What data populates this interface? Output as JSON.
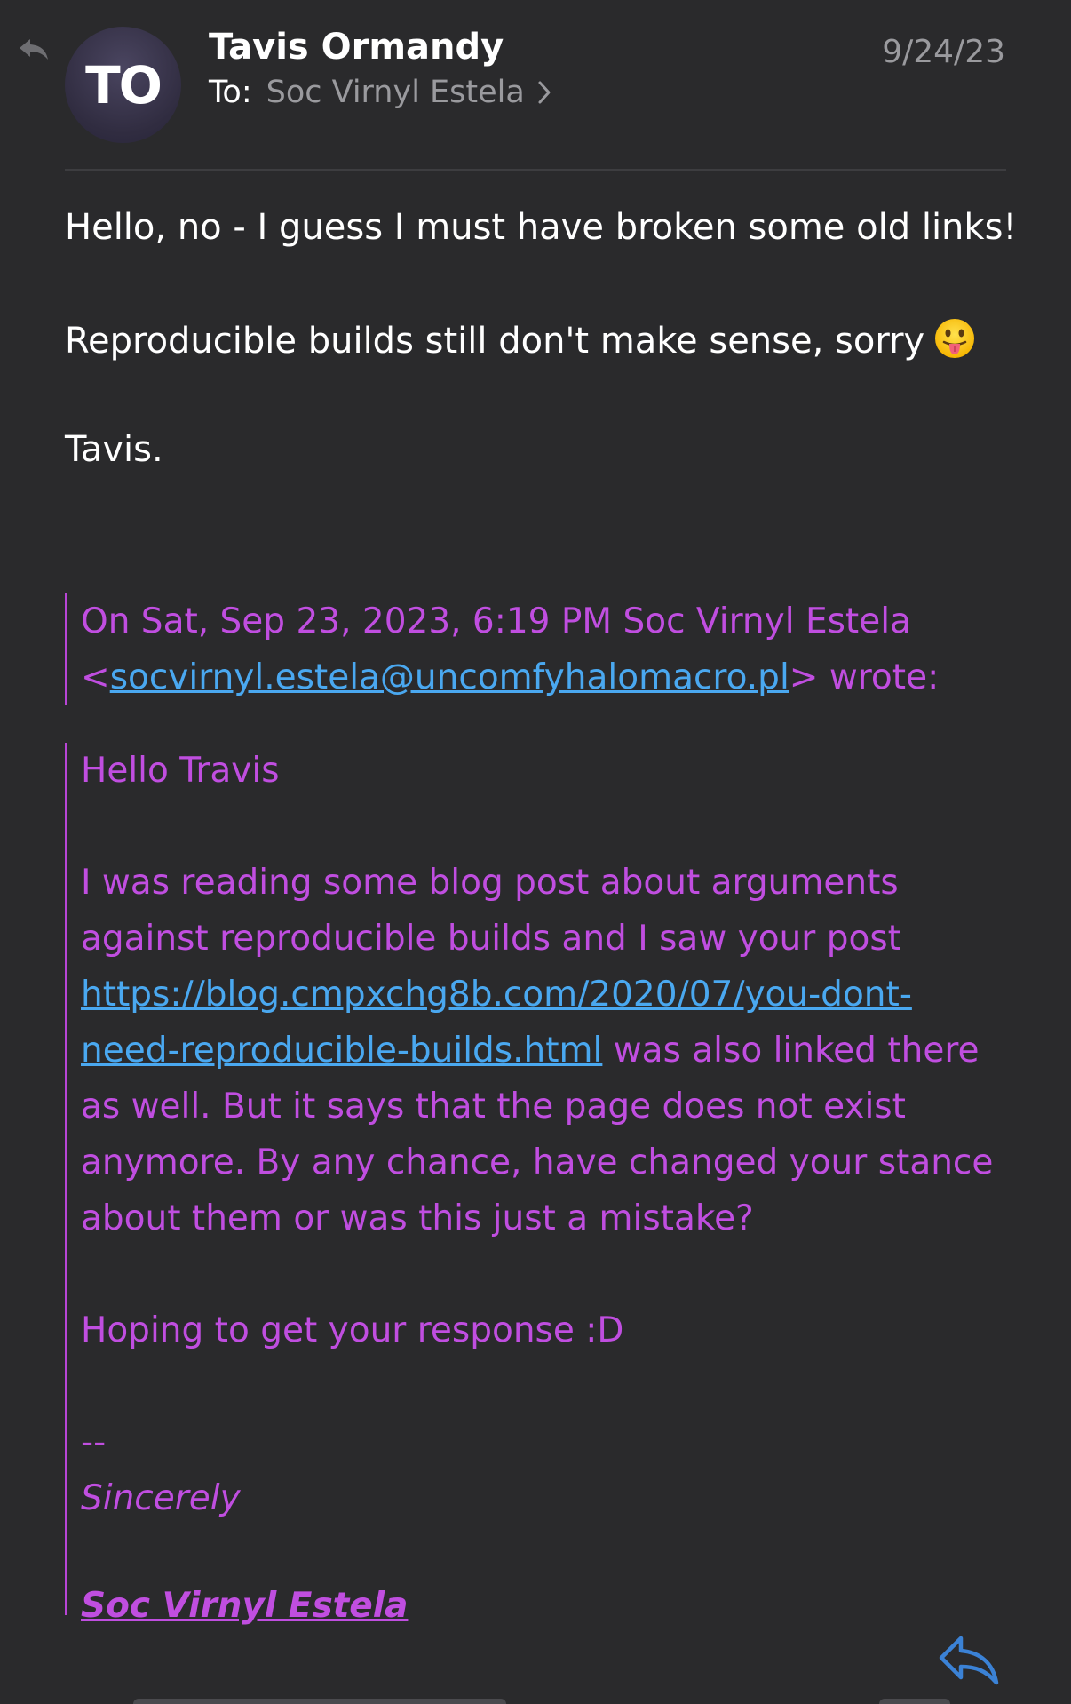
{
  "header": {
    "avatar_initials": "TO",
    "sender_name": "Tavis Ormandy",
    "to_label": "To:",
    "recipient": "Soc Virnyl Estela",
    "date": "9/24/23"
  },
  "message": {
    "line1": "Hello, no - I guess I must have broken some old links!",
    "line2": "Reproducible builds still don't make sense, sorry",
    "emoji": "face-with-tongue",
    "signoff": "Tavis."
  },
  "quote_header": {
    "line1": "On Sat, Sep 23, 2023, 6:19 PM Soc Virnyl Estela",
    "lt": "<",
    "email": "socvirnyl.estela@uncomfyhalomacro.pl",
    "after_email": "> wrote:"
  },
  "quote": {
    "greeting": "Hello Travis",
    "p1_line1": "I was reading some blog post about arguments",
    "p1_line2": "against reproducible builds and I saw your post",
    "p1_link_part1": "https://blog.cmpxchg8b.com/2020/07/you-dont-",
    "p1_link_part2": "need-reproducible-builds.html",
    "p1_line4_rest": " was also linked there",
    "p1_line5": "as well. But it says that the page does not exist",
    "p1_line6": "anymore. By any chance, have changed your stance",
    "p1_line7": "about them or was this just a mistake?",
    "p2": "Hoping to get your response :D",
    "sig_dashes": "--",
    "sig_sincerely": "Sincerely",
    "sig_name": "Soc Virnyl Estela"
  },
  "colors": {
    "background": "#2a2a2c",
    "quote": "#c04ee0",
    "link": "#4aa8f0",
    "secondary_text": "#9a9a9e",
    "reply_icon": "#3b82d6"
  },
  "icons": {
    "reply_indicator": "reply-arrow-icon",
    "chevron": "chevron-right-icon",
    "reply": "reply-icon"
  }
}
